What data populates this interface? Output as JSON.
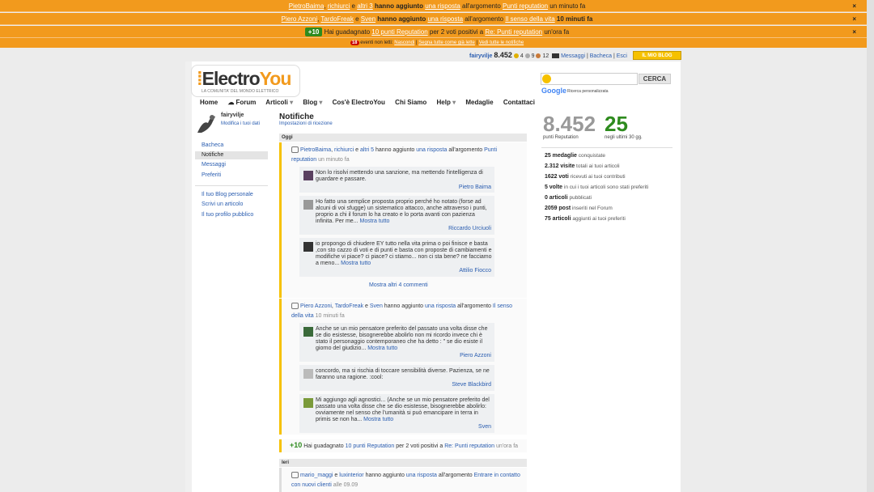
{
  "notif_bars": [
    {
      "u1": "PietroBaima",
      "u2": "richiurci",
      "mid": " e ",
      "u3": "altri 3",
      "text1": " hanno aggiunto ",
      "link1": "una risposta",
      "text2": " all'argomento ",
      "link2": "Punti reputation",
      "tail": " un minuto fa"
    },
    {
      "u1": "Piero Azzoni",
      "u2": "TardoFreak",
      "mid": " e ",
      "u3": "Sven",
      "text1": " hanno aggiunto ",
      "link1": "una risposta",
      "text2": " all'argomento ",
      "link2": "Il senso della vita",
      "tail": " 10 minuti fa"
    },
    {
      "plus": "+10",
      "text1": " Hai guadagnato ",
      "link1": "10 punti Reputation",
      "text2": " per 2 voti positivi a ",
      "link2": "Re: Punti reputation",
      "tail": " un'ora fa"
    }
  ],
  "close_label": "×",
  "unread": {
    "count": "18",
    "label": " eventi non letti: ",
    "hide": "Nascondi",
    "mark": "Segna tutte come già lette",
    "all": "Vedi tutte le notifiche"
  },
  "userbar": {
    "user": "fairyvilje",
    "points": "8.452",
    "gold": "4",
    "silver": "9",
    "bronze": "12",
    "messages": "Messaggi",
    "board": "Bacheca",
    "logout": "Esci",
    "blog_btn": "IL MIO BLOG"
  },
  "logo": {
    "brand_a": "Electro",
    "brand_b": "You",
    "tagline": "LA COMUNITA' DEL MONDO ELETTRICO"
  },
  "nav": [
    "Home",
    "Forum",
    "Articoli",
    "Blog",
    "Cos'è ElectroYou",
    "Chi Siamo",
    "Help",
    "Medaglie",
    "Contattaci"
  ],
  "profile": {
    "name": "fairyvilje",
    "modify": "Modifica i tuoi dati"
  },
  "menu": [
    "Bacheca",
    "Notifiche",
    "Messaggi",
    "Preferiti",
    "Il tuo Blog personale",
    "Scrivi un articolo",
    "Il tuo profilo pubblico"
  ],
  "page": {
    "title": "Notifiche",
    "settings": "Impostazioni di ricezione",
    "today": "Oggi",
    "yesterday": "Ieri"
  },
  "n1": {
    "a": "PietroBaima",
    "b": "richiurci",
    "c": "altri 5",
    "t1": " hanno aggiunto ",
    "r": "una risposta",
    "t2": " all'argomento ",
    "topic": "Punti reputation",
    "time": " un minuto fa"
  },
  "c1": {
    "text": "Non lo risolvi mettendo una sanzione, ma mettendo l'intelligenza di guardare e passare.",
    "author": "Pietro Baima"
  },
  "c2": {
    "text": "Ho fatto una semplice proposta proprio perché ho notato (forse ad alcuni di voi sfugge) un sistematico attacco, anche attraverso i punti, proprio a chi il forum lo ha creato e lo porta avanti con pazienza infinita. Per me...",
    "more": "Mostra tutto",
    "author": "Riccardo Urciuoli"
  },
  "c3": {
    "text": "io propongo di chiudere EY tutto nella vita prima o poi finisce e basta ,con sto cazzo di voti e di punti e basta con proposte di cambiamenti e modifiche vi piace? ci piace? ci stiamo... non ci sta bene? ne facciamo a meno...",
    "more": "Mostra tutto",
    "author": "Attilio Fiocco"
  },
  "more_comments": "Mostra altri 4 commenti",
  "n2": {
    "a": "Piero Azzoni",
    "b": "TardoFreak",
    "c": "Sven",
    "t1": " hanno aggiunto ",
    "r": "una risposta",
    "t2": " all'argomento ",
    "topic": "Il senso della vita",
    "time": " 10 minuti fa"
  },
  "c4": {
    "text": "Anche se un mio pensatore preferito del passato una volta disse che se dio esistesse, bisognerebbe abolirlo non mi ricordo invece chi è stato il personaggio contemporaneo che ha detto : \" se dio esiste il giorno del giudizio...",
    "more": "Mostra tutto",
    "author": "Piero Azzoni"
  },
  "c5": {
    "text": "concordo, ma si rischia di toccare sensibilità diverse. Pazienza, se ne faranno una ragione. :cool:",
    "author": "Steve Blackbird"
  },
  "c6": {
    "text": "Mi aggiungo agli agnostici... (Anche se un mio pensatore preferito del passato una volta disse che se dio esistesse, bisognerebbe abolirlo: ovviamente nel senso che l'umanità si può emancipare in terra in primis se non ha...",
    "more": "Mostra tutto",
    "author": "Sven"
  },
  "gain": {
    "plus": "+10",
    "t1": " Hai guadagnato ",
    "link": "10 punti Reputation",
    "t2": " per 2 voti positivi a ",
    "topic": "Re: Punti reputation",
    "time": " un'ora fa"
  },
  "n3": {
    "a": "mario_maggi",
    "b": "luxinterior",
    "t1": " hanno aggiunto ",
    "r": "una risposta",
    "t2": " all'argomento ",
    "topic": "Entrare in contatto con nuovi clienti",
    "time": " alle 09.09"
  },
  "search": {
    "button": "CERCA",
    "google": "Google",
    "custom": "Ricerca personalizzata"
  },
  "stats": {
    "points": "8.452",
    "points_label": "punti Reputation",
    "recent": "25",
    "recent_label": "negli ultimi 30 gg.",
    "lines": [
      {
        "n": "25",
        "k": "medaglie",
        "t": " conquistate"
      },
      {
        "n": "2.312",
        "k": "visite",
        "t": " totali ai tuoi articoli"
      },
      {
        "n": "1622",
        "k": "voti",
        "t": " ricevuti ai tuoi contributi"
      },
      {
        "n": "5",
        "k": "volte",
        "t": " in cui i tuoi articoli sono stati preferiti"
      },
      {
        "n": "0",
        "k": "articoli",
        "t": " pubblicati"
      },
      {
        "n": "2059",
        "k": "post",
        "t": " inseriti nel Forum"
      },
      {
        "n": "75",
        "k": "articoli",
        "t": " aggiunti ai tuoi preferiti"
      }
    ]
  }
}
